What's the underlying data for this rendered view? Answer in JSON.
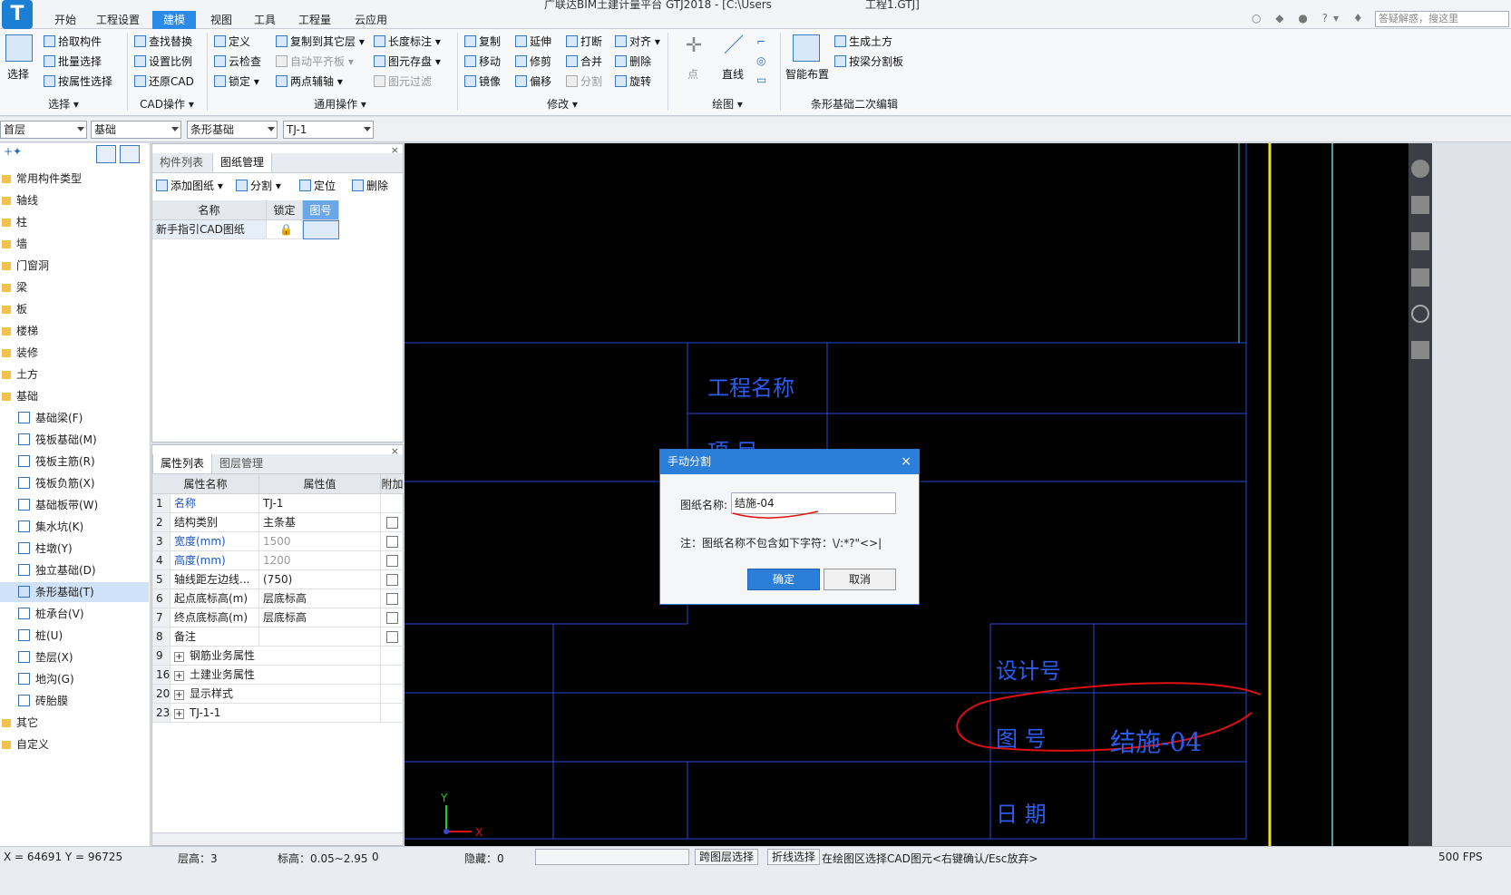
{
  "title": {
    "text": "广联达BIM土建计量平台 GTJ2018 - [C:\\Users",
    "project": "工程1.GTJ]",
    "search_placeholder": "答疑解惑，搜这里"
  },
  "menu": [
    "开始",
    "工程设置",
    "建模",
    "视图",
    "工具",
    "工程量",
    "云应用"
  ],
  "menu_active": "建模",
  "ribbon": {
    "select": {
      "big": "选择",
      "items": [
        "拾取构件",
        "批量选择",
        "按属性选择"
      ],
      "group": "选择"
    },
    "cad": {
      "items": [
        "查找替换",
        "设置比例",
        "还原CAD"
      ],
      "group": "CAD操作"
    },
    "common": {
      "items": [
        "定义",
        "云检查",
        "锁定",
        "复制到其它层",
        "自动平齐板",
        "两点辅轴",
        "长度标注",
        "图元存盘",
        "图元过滤"
      ],
      "group": "通用操作"
    },
    "modify": {
      "items": [
        "复制",
        "延伸",
        "打断",
        "对齐",
        "移动",
        "修剪",
        "合并",
        "删除",
        "镜像",
        "偏移",
        "分割",
        "旋转"
      ],
      "group": "修改"
    },
    "draw": {
      "items": [
        "点",
        "直线"
      ],
      "group": "绘图"
    },
    "second": {
      "items": [
        "智能布置",
        "生成土方",
        "按梁分割板"
      ],
      "group": "条形基础二次编辑"
    }
  },
  "selectors": [
    "首层",
    "基础",
    "条形基础",
    "TJ-1"
  ],
  "tree": [
    {
      "label": "常用构件类型",
      "type": "folder"
    },
    {
      "label": "轴线",
      "type": "folder"
    },
    {
      "label": "柱",
      "type": "folder"
    },
    {
      "label": "墙",
      "type": "folder"
    },
    {
      "label": "门窗洞",
      "type": "folder"
    },
    {
      "label": "梁",
      "type": "folder"
    },
    {
      "label": "板",
      "type": "folder"
    },
    {
      "label": "楼梯",
      "type": "folder"
    },
    {
      "label": "装修",
      "type": "folder"
    },
    {
      "label": "土方",
      "type": "folder"
    },
    {
      "label": "基础",
      "type": "folder"
    },
    {
      "label": "基础梁(F)",
      "type": "child"
    },
    {
      "label": "筏板基础(M)",
      "type": "child"
    },
    {
      "label": "筏板主筋(R)",
      "type": "child"
    },
    {
      "label": "筏板负筋(X)",
      "type": "child"
    },
    {
      "label": "基础板带(W)",
      "type": "child"
    },
    {
      "label": "集水坑(K)",
      "type": "child"
    },
    {
      "label": "柱墩(Y)",
      "type": "child"
    },
    {
      "label": "独立基础(D)",
      "type": "child"
    },
    {
      "label": "条形基础(T)",
      "type": "child",
      "selected": true
    },
    {
      "label": "桩承台(V)",
      "type": "child"
    },
    {
      "label": "桩(U)",
      "type": "child"
    },
    {
      "label": "垫层(X)",
      "type": "child"
    },
    {
      "label": "地沟(G)",
      "type": "child"
    },
    {
      "label": "砖胎膜",
      "type": "child"
    },
    {
      "label": "其它",
      "type": "folder"
    },
    {
      "label": "自定义",
      "type": "folder"
    }
  ],
  "drawing_panel": {
    "tabs": [
      "构件列表",
      "图纸管理"
    ],
    "tools": [
      "添加图纸",
      "分割",
      "定位",
      "删除"
    ],
    "headers": [
      "名称",
      "锁定",
      "图号"
    ],
    "rows": [
      {
        "name": "新手指引CAD图纸"
      }
    ]
  },
  "prop_panel": {
    "tabs": [
      "属性列表",
      "图层管理"
    ],
    "headers": [
      "属性名称",
      "属性值",
      "附加"
    ],
    "rows": [
      {
        "n": "1",
        "name": "名称",
        "value": "TJ-1",
        "style": "blue",
        "chk": false
      },
      {
        "n": "2",
        "name": "结构类别",
        "value": "主条基",
        "style": "",
        "chk": true
      },
      {
        "n": "3",
        "name": "宽度(mm)",
        "value": "1500",
        "style": "blue",
        "valstyle": "grey",
        "chk": true
      },
      {
        "n": "4",
        "name": "高度(mm)",
        "value": "1200",
        "style": "blue",
        "valstyle": "grey",
        "chk": true
      },
      {
        "n": "5",
        "name": "轴线距左边线...",
        "value": "(750)",
        "style": "",
        "chk": true
      },
      {
        "n": "6",
        "name": "起点底标高(m)",
        "value": "层底标高",
        "style": "",
        "chk": true
      },
      {
        "n": "7",
        "name": "终点底标高(m)",
        "value": "层底标高",
        "style": "",
        "chk": true
      },
      {
        "n": "8",
        "name": "备注",
        "value": "",
        "style": "",
        "chk": true
      },
      {
        "n": "9",
        "name": "钢筋业务属性",
        "value": "",
        "style": "",
        "expand": true
      },
      {
        "n": "16",
        "name": "土建业务属性",
        "value": "",
        "style": "",
        "expand": true
      },
      {
        "n": "20",
        "name": "显示样式",
        "value": "",
        "style": "",
        "expand": true
      },
      {
        "n": "23",
        "name": "TJ-1-1",
        "value": "",
        "style": "",
        "expand": true
      }
    ]
  },
  "cad": {
    "labels": [
      "工程名称",
      "项 目",
      "设计号",
      "图 号",
      "结施-04",
      "日 期"
    ],
    "axis_x": "X",
    "axis_y": "Y"
  },
  "dialog": {
    "title": "手动分割",
    "field_label": "图纸名称:",
    "field_value": "结施-04",
    "note": "注：图纸名称不包含如下字符：\\/:*?\"<>|",
    "ok": "确定",
    "cancel": "取消"
  },
  "status": {
    "coords": "X = 64691 Y = 96725",
    "layer": "层高：3",
    "elev": "标高：0.05~2.95",
    "zero": "0",
    "hidden": "隐藏：0",
    "btn1": "跨图层选择",
    "btn2": "折线选择",
    "hint": "在绘图区选择CAD图元<右键确认/Esc放弃>",
    "fps": "500 FPS"
  },
  "colors": {
    "accent": "#2b7fd8",
    "cad_line": "#2a4ad8",
    "cad_text": "#2b5cf0",
    "cad_yellow": "#f0e21a",
    "cad_cyan": "#5fd8d8",
    "annot_red": "#e01010"
  }
}
